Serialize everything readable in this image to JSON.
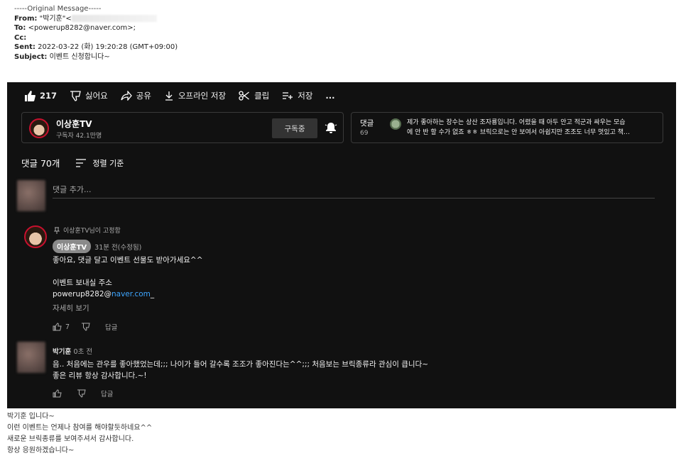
{
  "email": {
    "original_message": "-----Original Message-----",
    "from_label": "From:",
    "from_value": "\"박기훈\"<",
    "to_label": "To:",
    "to_value": "<powerup8282@naver.com>;",
    "cc_label": "Cc:",
    "sent_label": "Sent:",
    "sent_value": "2022-03-22 (화) 19:20:28 (GMT+09:00)",
    "subject_label": "Subject:",
    "subject_value": "이벤트 신청합니다~"
  },
  "video_actions": {
    "likes": "217",
    "dislike": "싫어요",
    "share": "공유",
    "offline_save": "오프라인 저장",
    "clip": "클립",
    "save": "저장",
    "more": "..."
  },
  "channel": {
    "name": "이상훈TV",
    "subscribers": "구독자 42.1만명",
    "subscribe_label": "구독중"
  },
  "comments_preview": {
    "label": "댓글",
    "count": "69",
    "text_line1": "제가 좋아하는 장수는 상산 조자룡입니다. 어렸을 때 아두 안고 적군과 싸우는 모습",
    "text_line2": "에 안 반 할 수가 없죠 ㅎㅎ 브릭으로는 안 보여서 아쉽지만 조조도 너무 멋있고 책…"
  },
  "comments": {
    "count_label": "댓글 70개",
    "sort_label": "정렬 기준",
    "add_placeholder": "댓글 추가...",
    "pinned": {
      "pinned_by": "이상훈TV님이 고정함",
      "author": "이상훈TV",
      "time": "31분 전(수정됨)",
      "line1": "좋아요, 댓글 달고 이벤트 선물도 받아가세요^^",
      "line2": "이벤트 보내실 주소",
      "line3_user": "powerup8282@",
      "line3_link": "naver.com",
      "line3_suffix": "_",
      "more": "자세히 보기",
      "likes": "7",
      "reply": "답글"
    },
    "second": {
      "author": "박기훈",
      "time": "0초 전",
      "line1": "음.. 처음에는 관우를 좋아했었는데;;; 나이가 들어 갈수록 조조가 좋아진다는^^;;; 처음보는 브릭종류라 관심이 큽니다~",
      "line2": "좋은 리뷰 항상 감사합니다.~!",
      "reply": "답글"
    }
  },
  "reply_body": {
    "line1": "박기훈 입니다~",
    "line2": "이런 이벤트는 언제나 참여를 해야할듯하네요^^",
    "line3": "새로운 브릭종류를 보여주셔서 감사합니다.",
    "line4": "항상 응원하겠습니다~"
  }
}
